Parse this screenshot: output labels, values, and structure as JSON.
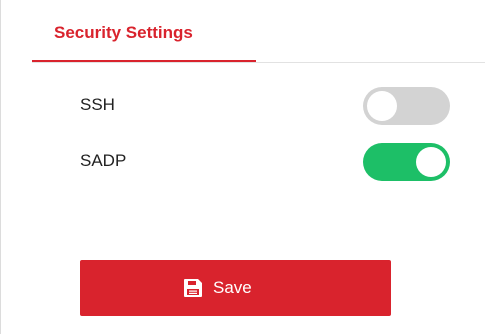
{
  "header": {
    "tab_label": "Security Settings"
  },
  "settings": [
    {
      "label": "SSH",
      "enabled": false
    },
    {
      "label": "SADP",
      "enabled": true
    }
  ],
  "actions": {
    "save_label": "Save"
  },
  "colors": {
    "accent": "#d9232d",
    "toggle_on": "#1dbf67",
    "toggle_off": "#d3d3d3"
  },
  "icons": {
    "save": "floppy-disk-icon"
  }
}
